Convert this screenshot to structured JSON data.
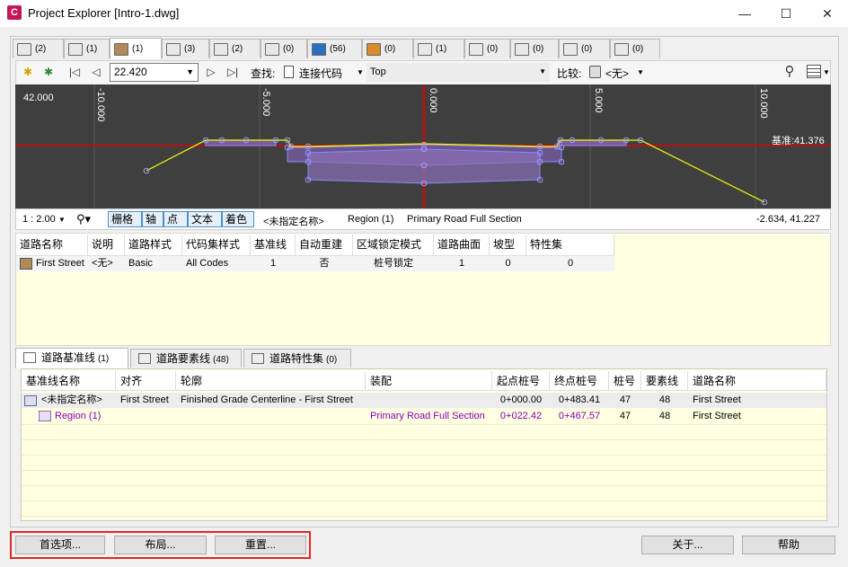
{
  "window": {
    "app_icon_text": "C",
    "title": "Project Explorer [Intro-1.dwg]",
    "minimize": "—",
    "maximize": "☐",
    "close": "✕"
  },
  "top_tabs": [
    {
      "icon": "alignment-icon",
      "count": "(2)"
    },
    {
      "icon": "profile-icon",
      "count": "(1)"
    },
    {
      "icon": "corridor-icon",
      "count": "(1)",
      "active": true
    },
    {
      "icon": "assembly-icon",
      "count": "(3)"
    },
    {
      "icon": "surface-icon",
      "count": "(2)"
    },
    {
      "icon": "feature-line-icon",
      "count": "(0)"
    },
    {
      "icon": "parcel-icon",
      "count": "(56)"
    },
    {
      "icon": "site-icon",
      "count": "(0)"
    },
    {
      "icon": "structure-icon",
      "count": "(1)"
    },
    {
      "icon": "pipe-network-icon",
      "count": "(0)"
    },
    {
      "icon": "grading-icon",
      "count": "(0)"
    },
    {
      "icon": "intersection-icon",
      "count": "(0)"
    },
    {
      "icon": "sheet-icon",
      "count": "(0)"
    }
  ],
  "toolbar": {
    "offset_value": "22.420",
    "find_label": "查找:",
    "find_target": "连接代码",
    "find_value": "Top",
    "compare_label": "比较:",
    "compare_value": "<无>"
  },
  "viewer": {
    "y_label": "42.000",
    "x_ticks": [
      "-10.000",
      "-5.000",
      "0.000",
      "5.000",
      "10.000"
    ],
    "datum_label": "基准:41.376"
  },
  "viewbar": {
    "scale": "1 : 2.00",
    "toggles": [
      "栅格",
      "轴",
      "点",
      "文本",
      "着色"
    ],
    "name": "<未指定名称>",
    "region": "Region (1)",
    "assembly": "Primary Road Full Section",
    "coords": "-2.634, 41.227"
  },
  "corridor_grid": {
    "headers": [
      "道路名称",
      "说明",
      "道路样式",
      "代码集样式",
      "基准线",
      "自动重建",
      "区域锁定模式",
      "道路曲面",
      "坡型",
      "特性集"
    ],
    "row": [
      "First Street",
      "<无>",
      "Basic",
      "All Codes",
      "1",
      "否",
      "桩号锁定",
      "1",
      "0",
      "0"
    ]
  },
  "bottom_tabs": [
    {
      "label": "道路基准线",
      "count": "(1)",
      "active": true
    },
    {
      "label": "道路要素线",
      "count": "(48)"
    },
    {
      "label": "道路特性集",
      "count": "(0)"
    }
  ],
  "baseline_grid": {
    "headers": [
      "基准线名称",
      "对齐",
      "轮廓",
      "装配",
      "起点桩号",
      "终点桩号",
      "桩号",
      "要素线",
      "道路名称"
    ],
    "rows": [
      [
        "<未指定名称>",
        "First Street",
        "Finished Grade Centerline - First Street",
        "",
        "0+000.00",
        "0+483.41",
        "47",
        "48",
        "First Street"
      ],
      [
        "Region (1)",
        "",
        "",
        "Primary Road Full Section",
        "0+022.42",
        "0+467.57",
        "47",
        "48",
        "First Street"
      ]
    ]
  },
  "buttons": {
    "options": "首选项...",
    "layout": "布局...",
    "reset": "重置...",
    "about": "关于...",
    "help": "帮助"
  },
  "colors": {
    "viewer_bg": "#3f3f3f",
    "axis_red": "#e00000",
    "link_yellow": "#ffff00",
    "shape_fill": "#7a5fa8",
    "point_blue": "#7d7dff",
    "highlight_red": "#e32626",
    "region_purple": "#8b00b8",
    "grid_bg": "#ffffe1"
  }
}
